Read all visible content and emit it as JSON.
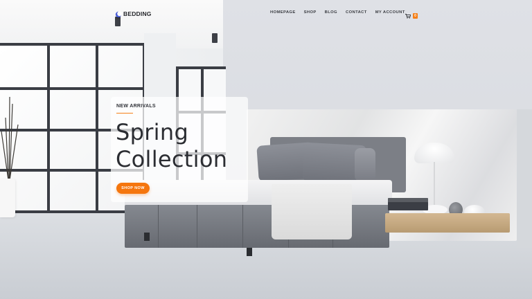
{
  "header": {
    "logo_text": "BEDDING",
    "nav": [
      {
        "label": "HOMEPAGE"
      },
      {
        "label": "SHOP"
      },
      {
        "label": "BLOG"
      },
      {
        "label": "CONTACT"
      },
      {
        "label": "MY ACCOUNT"
      }
    ],
    "cart_count": "0"
  },
  "hero": {
    "eyebrow": "NEW ARRIVALS",
    "headline_line1": "Spring",
    "headline_line2": "Collection",
    "cta_label": "SHOP NOW"
  },
  "colors": {
    "accent": "#f5760e",
    "text_dark": "#2b2d32",
    "logo_mark": "#4b5fd6"
  },
  "icons": {
    "logo": "moon-logo-icon",
    "cart": "cart-icon"
  }
}
